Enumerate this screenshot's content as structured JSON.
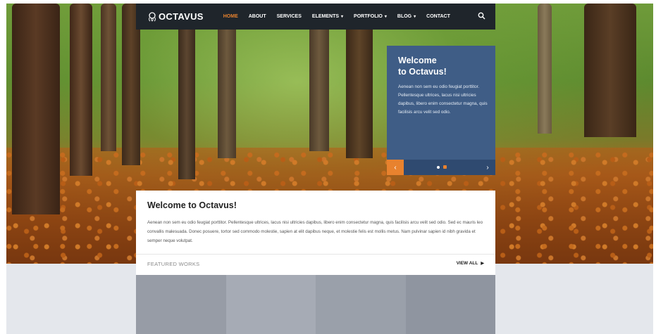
{
  "brand": {
    "name": "OCTAVUS",
    "logo_icon": "octopus-icon"
  },
  "nav": {
    "items": [
      {
        "label": "HOME",
        "active": true,
        "dropdown": false
      },
      {
        "label": "ABOUT",
        "active": false,
        "dropdown": false
      },
      {
        "label": "SERVICES",
        "active": false,
        "dropdown": false
      },
      {
        "label": "ELEMENTS",
        "active": false,
        "dropdown": true
      },
      {
        "label": "PORTFOLIO",
        "active": false,
        "dropdown": true
      },
      {
        "label": "BLOG",
        "active": false,
        "dropdown": true
      },
      {
        "label": "CONTACT",
        "active": false,
        "dropdown": false
      }
    ],
    "search_icon": "search-icon"
  },
  "slider": {
    "title_line1": "Welcome",
    "title_line2": "to Octavus!",
    "text": "Aenean non sem eu odio feugiat porttitor. Pellentesque ultrices, lacus nisi ultricies dapibus, libero enim consectetur magna, quis facilisis arcu velit sed odio.",
    "prev_icon": "chevron-left-icon",
    "next_icon": "chevron-right-icon",
    "slide_count": 2,
    "active_slide": 2
  },
  "welcome": {
    "title": "Welcome to Octavus!",
    "text": "Aenean non sem eu odio feugiat porttitor. Pellentesque ultrices, lacus nisi ultricies dapibus, libero enim consectetur magna, quis facilisis arcu velit sed odio. Sed ec mauris leo convallis malesuada. Donec posuere, tortor sed commodo molestie, sapien at elit dapibus neque, et molestie felis est mollis metus. Nam pulvinar sapien id nibh gravida et semper neque volutpat."
  },
  "featured": {
    "label": "FEATURED WORKS",
    "view_all": "VIEW ALL",
    "tiles": [
      {
        "color": "#979ca6"
      },
      {
        "color": "#a6abb5"
      },
      {
        "color": "#9aa0aa"
      },
      {
        "color": "#8f95a0"
      }
    ]
  },
  "colors": {
    "accent": "#e8822e",
    "navbar": "#1f252b",
    "slider_box": "#3f5d86",
    "lower_bg": "#e4e7ec"
  }
}
